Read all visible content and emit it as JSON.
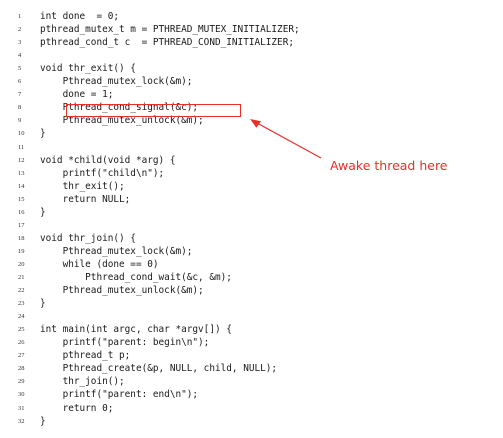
{
  "code_lines": [
    {
      "num": "1",
      "text": "int done  = 0;"
    },
    {
      "num": "2",
      "text": "pthread_mutex_t m = PTHREAD_MUTEX_INITIALIZER;"
    },
    {
      "num": "3",
      "text": "pthread_cond_t c  = PTHREAD_COND_INITIALIZER;"
    },
    {
      "num": "4",
      "text": ""
    },
    {
      "num": "5",
      "text": "void thr_exit() {"
    },
    {
      "num": "6",
      "text": "    Pthread_mutex_lock(&m);"
    },
    {
      "num": "7",
      "text": "    done = 1;"
    },
    {
      "num": "8",
      "text": "    Pthread_cond_signal(&c);"
    },
    {
      "num": "9",
      "text": "    Pthread_mutex_unlock(&m);"
    },
    {
      "num": "10",
      "text": "}"
    },
    {
      "num": "11",
      "text": ""
    },
    {
      "num": "12",
      "text": "void *child(void *arg) {"
    },
    {
      "num": "13",
      "text": "    printf(\"child\\n\");"
    },
    {
      "num": "14",
      "text": "    thr_exit();"
    },
    {
      "num": "15",
      "text": "    return NULL;"
    },
    {
      "num": "16",
      "text": "}"
    },
    {
      "num": "17",
      "text": ""
    },
    {
      "num": "18",
      "text": "void thr_join() {"
    },
    {
      "num": "19",
      "text": "    Pthread_mutex_lock(&m);"
    },
    {
      "num": "20",
      "text": "    while (done == 0)"
    },
    {
      "num": "21",
      "text": "        Pthread_cond_wait(&c, &m);"
    },
    {
      "num": "22",
      "text": "    Pthread_mutex_unlock(&m);"
    },
    {
      "num": "23",
      "text": "}"
    },
    {
      "num": "24",
      "text": ""
    },
    {
      "num": "25",
      "text": "int main(int argc, char *argv[]) {"
    },
    {
      "num": "26",
      "text": "    printf(\"parent: begin\\n\");"
    },
    {
      "num": "27",
      "text": "    pthread_t p;"
    },
    {
      "num": "28",
      "text": "    Pthread_create(&p, NULL, child, NULL);"
    },
    {
      "num": "29",
      "text": "    thr_join();"
    },
    {
      "num": "30",
      "text": "    printf(\"parent: end\\n\");"
    },
    {
      "num": "31",
      "text": "    return 0;"
    },
    {
      "num": "32",
      "text": "}"
    }
  ],
  "annotation": {
    "label": "Awake thread here",
    "color": "#e8302a",
    "highlighted_line": "8"
  }
}
